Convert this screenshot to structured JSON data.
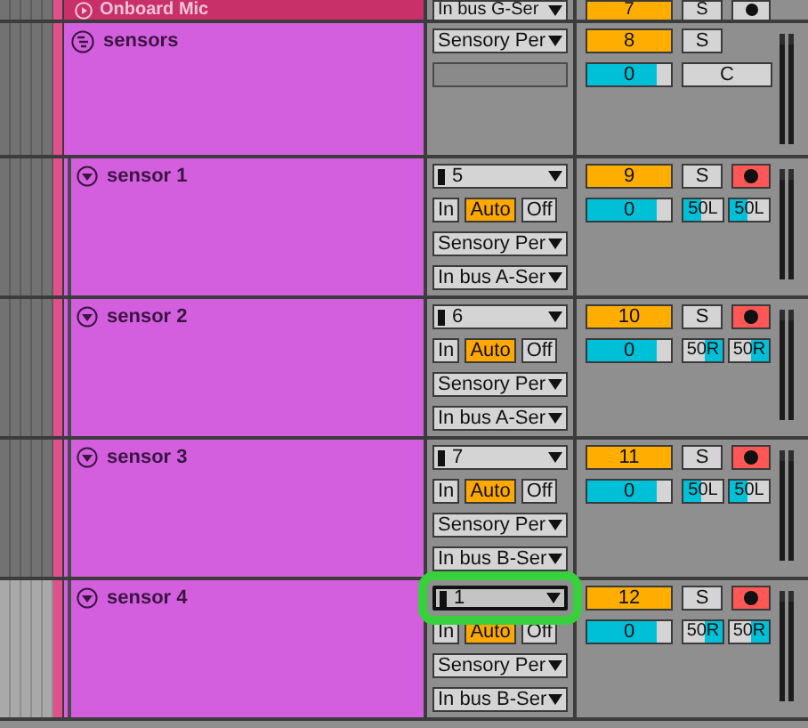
{
  "top_track": {
    "name": "Onboard Mic",
    "color": "#c8306a",
    "output": "In bus G-Ser",
    "number": "7",
    "solo": "S",
    "armed": false
  },
  "group": {
    "name": "sensors",
    "color": "#d35fdf",
    "output": "Sensory Per",
    "number": "8",
    "solo": "S",
    "volume": "0",
    "level": 0.83,
    "pan": "C"
  },
  "tracks": [
    {
      "name": "sensor 1",
      "selected": false,
      "input": "5",
      "highlighted": false,
      "monitor": [
        {
          "label": "In",
          "selected": false
        },
        {
          "label": "Auto",
          "selected": true
        },
        {
          "label": "Off",
          "selected": false
        }
      ],
      "output": "Sensory Per",
      "routing": "In bus A-Ser",
      "number": "9",
      "solo": "S",
      "armed": true,
      "volume": "0",
      "level": 0.83,
      "pans": [
        {
          "label": "50L",
          "kind": "left",
          "level": 0.45
        },
        {
          "label": "50L",
          "kind": "left",
          "level": 0.45
        }
      ]
    },
    {
      "name": "sensor 2",
      "selected": false,
      "input": "6",
      "highlighted": false,
      "monitor": [
        {
          "label": "In",
          "selected": false
        },
        {
          "label": "Auto",
          "selected": true
        },
        {
          "label": "Off",
          "selected": false
        }
      ],
      "output": "Sensory Per",
      "routing": "In bus A-Ser",
      "number": "10",
      "solo": "S",
      "armed": true,
      "volume": "0",
      "level": 0.83,
      "pans": [
        {
          "label": "50R",
          "kind": "right",
          "level": 0.45
        },
        {
          "label": "50R",
          "kind": "right",
          "level": 0.45
        }
      ]
    },
    {
      "name": "sensor 3",
      "selected": false,
      "input": "7",
      "highlighted": false,
      "monitor": [
        {
          "label": "In",
          "selected": false
        },
        {
          "label": "Auto",
          "selected": true
        },
        {
          "label": "Off",
          "selected": false
        }
      ],
      "output": "Sensory Per",
      "routing": "In bus B-Ser",
      "number": "11",
      "solo": "S",
      "armed": true,
      "volume": "0",
      "level": 0.83,
      "pans": [
        {
          "label": "50L",
          "kind": "left",
          "level": 0.45
        },
        {
          "label": "50L",
          "kind": "left",
          "level": 0.45
        }
      ]
    },
    {
      "name": "sensor 4",
      "selected": true,
      "input": "1",
      "highlighted": true,
      "monitor": [
        {
          "label": "In",
          "selected": false
        },
        {
          "label": "Auto",
          "selected": true
        },
        {
          "label": "Off",
          "selected": false
        }
      ],
      "output": "Sensory Per",
      "routing": "In bus B-Ser",
      "number": "12",
      "solo": "S",
      "armed": true,
      "volume": "0",
      "level": 0.83,
      "pans": [
        {
          "label": "50R",
          "kind": "right",
          "level": 0.45
        },
        {
          "label": "50R",
          "kind": "right",
          "level": 0.45
        }
      ]
    }
  ]
}
